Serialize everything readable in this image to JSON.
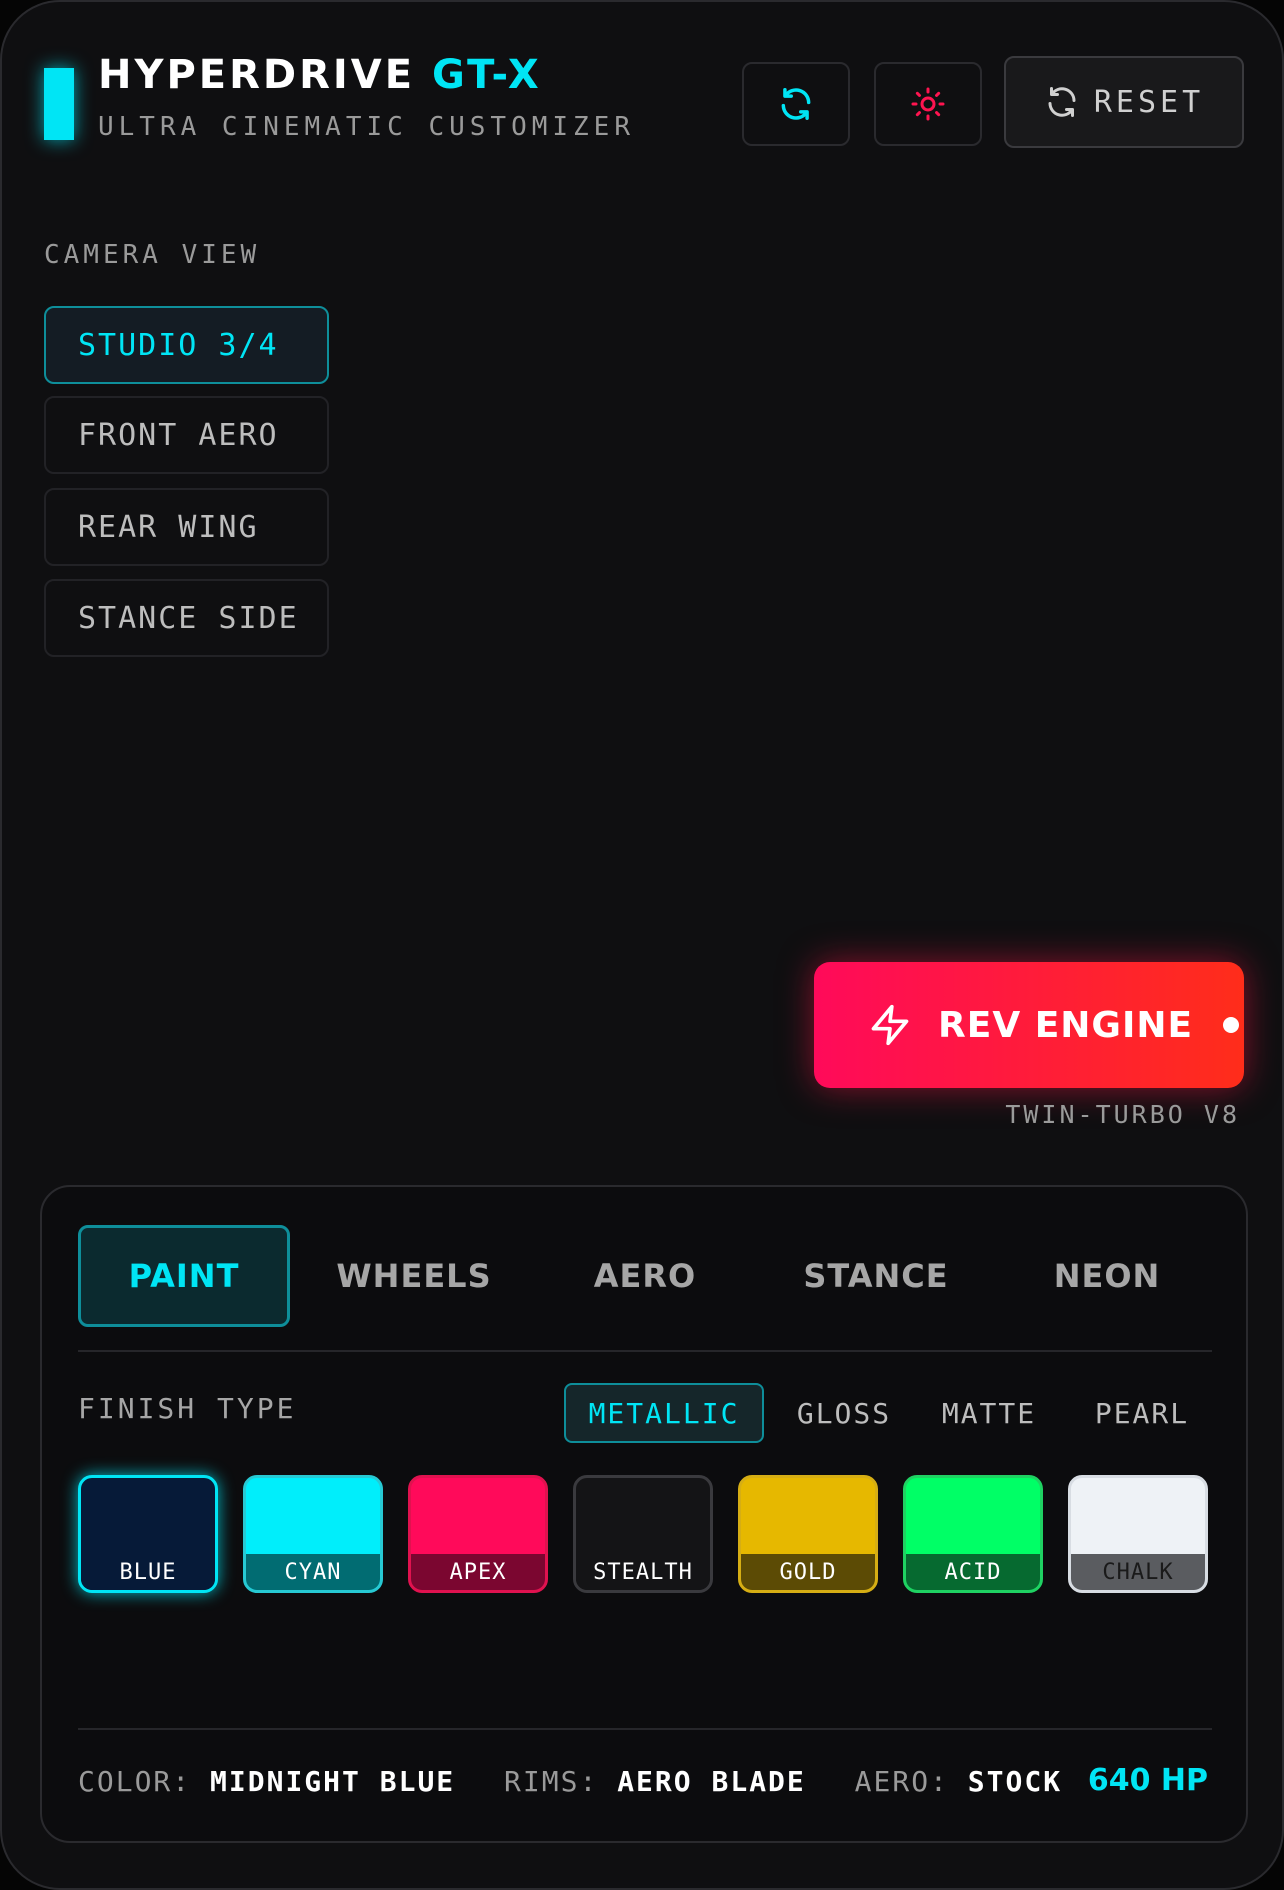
{
  "header": {
    "title_main": "HYPERDRIVE",
    "title_accent": "GT-X",
    "subtitle": "ULTRA CINEMATIC CUSTOMIZER",
    "reset_label": "RESET",
    "accent_color": "#00e5f5",
    "alert_color": "#ff1450"
  },
  "camera": {
    "label": "CAMERA VIEW",
    "views": [
      {
        "label": "STUDIO 3/4",
        "active": true
      },
      {
        "label": "FRONT AERO",
        "active": false
      },
      {
        "label": "REAR WING",
        "active": false
      },
      {
        "label": "STANCE SIDE",
        "active": false
      }
    ]
  },
  "rev": {
    "label": "REV ENGINE",
    "engine": "TWIN-TURBO V8",
    "gradient": [
      "#ff0a5a",
      "#ff2d1a"
    ]
  },
  "tabs": [
    {
      "label": "PAINT",
      "active": true
    },
    {
      "label": "WHEELS",
      "active": false
    },
    {
      "label": "AERO",
      "active": false
    },
    {
      "label": "STANCE",
      "active": false
    },
    {
      "label": "NEON",
      "active": false
    }
  ],
  "finish": {
    "label": "FINISH TYPE",
    "options": [
      {
        "label": "METALLIC",
        "active": true
      },
      {
        "label": "GLOSS",
        "active": false
      },
      {
        "label": "MATTE",
        "active": false
      },
      {
        "label": "PEARL",
        "active": false
      }
    ]
  },
  "swatches": [
    {
      "label": "BLUE",
      "color": "#061a38",
      "cap": "#061a38",
      "border": "#00e5f5",
      "text": "#ffffff",
      "selected": true
    },
    {
      "label": "CYAN",
      "color": "#00eefb",
      "cap": "#016c72",
      "border": "#27c9d3",
      "text": "#ffffff",
      "selected": false
    },
    {
      "label": "APEX",
      "color": "#ff0a5a",
      "cap": "#7b0630",
      "border": "#e0124f",
      "text": "#ffffff",
      "selected": false
    },
    {
      "label": "STEALTH",
      "color": "#141416",
      "cap": "#141416",
      "border": "#3a3a3e",
      "text": "#ffffff",
      "selected": false
    },
    {
      "label": "GOLD",
      "color": "#e6b800",
      "cap": "#5c4b05",
      "border": "#d6ae14",
      "text": "#ffffff",
      "selected": false
    },
    {
      "label": "ACID",
      "color": "#00ff66",
      "cap": "#066a30",
      "border": "#1fd262",
      "text": "#ffffff",
      "selected": false
    },
    {
      "label": "CHALK",
      "color": "#eef2f6",
      "cap": "#5a5c60",
      "border": "#d8dde3",
      "text": "#1a1a1a",
      "selected": false
    }
  ],
  "summary": {
    "color_label": "COLOR:",
    "color_value": "MIDNIGHT BLUE",
    "rims_label": "RIMS:",
    "rims_value": "AERO BLADE",
    "aero_label": "AERO:",
    "aero_value": "STOCK",
    "hp": "640 HP"
  }
}
